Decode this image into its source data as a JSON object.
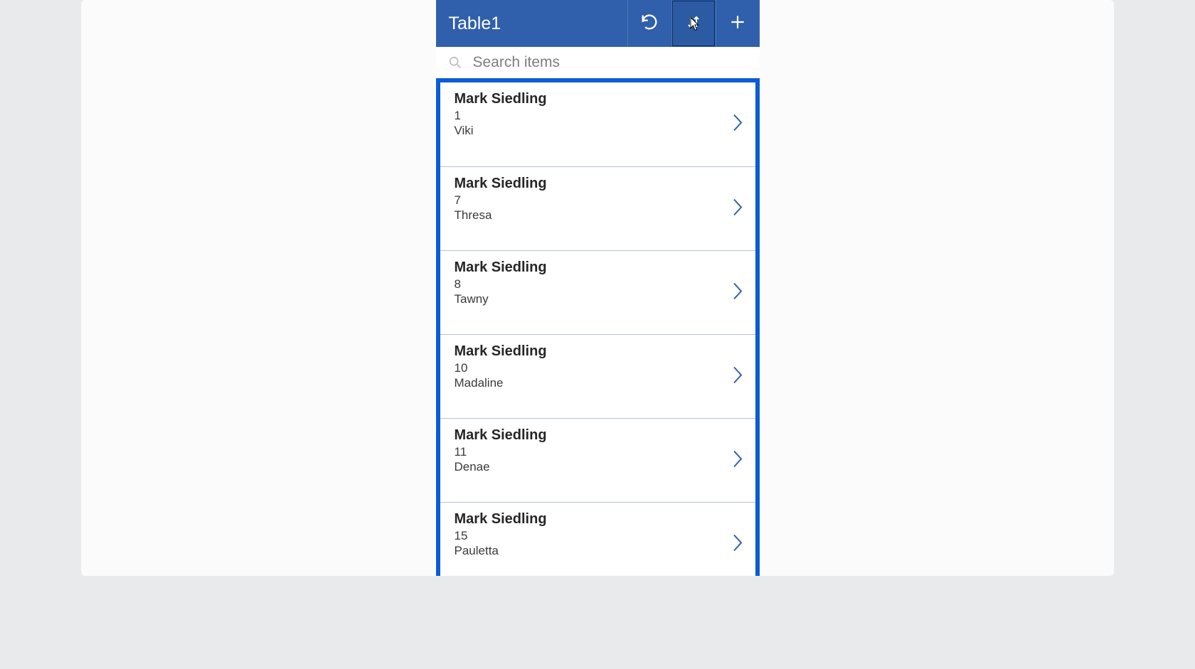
{
  "colors": {
    "accent": "#3060ac",
    "selection": "#0b5cd6"
  },
  "header": {
    "title": "Table1",
    "refresh_icon": "refresh-icon",
    "sort_icon": "sort-icon",
    "add_icon": "plus-icon"
  },
  "search": {
    "placeholder": "Search items",
    "value": ""
  },
  "items": [
    {
      "title": "Mark Siedling",
      "num": "1",
      "sub": "Viki"
    },
    {
      "title": "Mark Siedling",
      "num": "7",
      "sub": "Thresa"
    },
    {
      "title": "Mark Siedling",
      "num": "8",
      "sub": "Tawny"
    },
    {
      "title": "Mark Siedling",
      "num": "10",
      "sub": "Madaline"
    },
    {
      "title": "Mark Siedling",
      "num": "11",
      "sub": "Denae"
    },
    {
      "title": "Mark Siedling",
      "num": "15",
      "sub": "Pauletta"
    }
  ]
}
